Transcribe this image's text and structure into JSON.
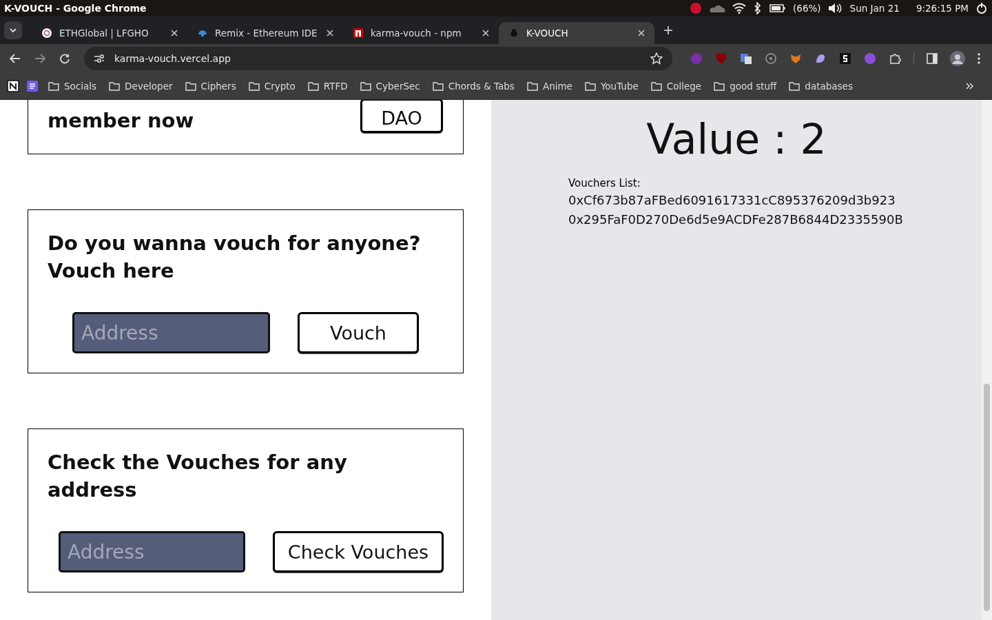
{
  "os_bar": {
    "title": "K-VOUCH - Google Chrome",
    "battery": "(66%)",
    "date": "Sun Jan 21",
    "time": "9:26:15 PM"
  },
  "tabs": [
    {
      "label": "ETHGlobal | LFGHO",
      "selected": false
    },
    {
      "label": "Remix - Ethereum IDE",
      "selected": false
    },
    {
      "label": "karma-vouch - npm",
      "selected": false
    },
    {
      "label": "K-VOUCH",
      "selected": true
    }
  ],
  "address_bar": {
    "url": "karma-vouch.vercel.app"
  },
  "bookmarks": [
    "Socials",
    "Developer",
    "Ciphers",
    "Crypto",
    "RTFD",
    "CyberSec",
    "Chords & Tabs",
    "Anime",
    "YouTube",
    "College",
    "good stuff",
    "databases"
  ],
  "dao_card": {
    "text": "member now",
    "button": "DAO"
  },
  "vouch_card": {
    "heading": [
      "Do you wanna vouch for anyone?",
      "Vouch here"
    ],
    "input": {
      "placeholder": "Address"
    },
    "button": "Vouch"
  },
  "check_card": {
    "heading": [
      "Check the Vouches for any",
      "address"
    ],
    "input": {
      "placeholder": "Address"
    },
    "button": "Check Vouches"
  },
  "result_panel": {
    "value": "Value : 2",
    "list_label": "Vouchers List:",
    "vouchers": [
      "0xCf673b87aFBed6091617331cC895376209d3b923",
      "0x295FaF0D270De6d5e9ACDFe287B6844D2335590B"
    ]
  }
}
